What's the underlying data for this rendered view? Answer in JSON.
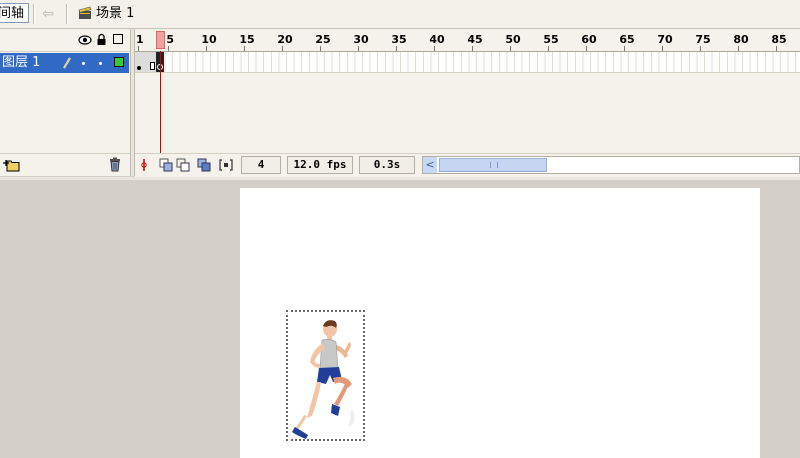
{
  "toolbar": {
    "timeline_tab_label": "间轴",
    "scene_label": "场景 1"
  },
  "layers": {
    "items": [
      {
        "name": "图层 1"
      }
    ]
  },
  "ruler": {
    "ticks": [
      "1",
      "5",
      "10",
      "15",
      "20",
      "25",
      "30",
      "35",
      "40",
      "45",
      "50",
      "55",
      "60",
      "65",
      "70",
      "75",
      "80",
      "85"
    ]
  },
  "timeline_status": {
    "current_frame": "4",
    "frame_rate": "12.0 fps",
    "elapsed_time": "0.3s"
  },
  "colors": {
    "selected_layer": "#316ac5",
    "playhead": "#cc0000",
    "outline_swatch": "#33cc33"
  }
}
